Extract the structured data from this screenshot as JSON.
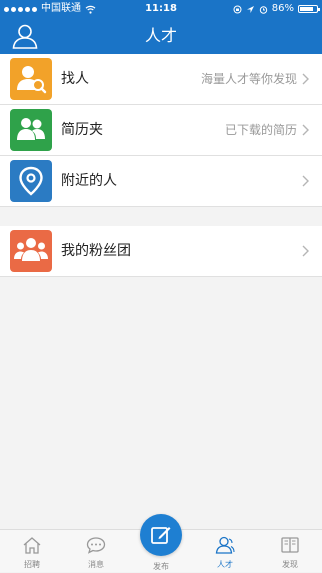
{
  "status_bar": {
    "carrier": "中国联通",
    "time": "11:18",
    "battery": "86%",
    "battery_level_percent": 86
  },
  "header": {
    "title": "人才",
    "profile_icon": "person-outline-icon"
  },
  "menu_top": [
    {
      "label": "找人",
      "desc": "海量人才等你发现",
      "icon": "search-person-icon",
      "color": "#f2a229"
    },
    {
      "label": "简历夹",
      "desc": "已下载的简历",
      "icon": "people-icon",
      "color": "#2fa24a"
    },
    {
      "label": "附近的人",
      "desc": "",
      "icon": "location-pin-icon",
      "color": "#2b7bc3"
    }
  ],
  "menu_bottom": [
    {
      "label": "我的粉丝团",
      "desc": "",
      "icon": "group-icon",
      "color": "#ea6a45"
    }
  ],
  "tab_bar": {
    "tabs": [
      {
        "label": "招聘",
        "icon": "home-icon",
        "active": false
      },
      {
        "label": "消息",
        "icon": "chat-bubble-icon",
        "active": false
      },
      {
        "label": "发布",
        "icon": "edit-icon",
        "active": false
      },
      {
        "label": "人才",
        "icon": "person-icon",
        "active": true
      },
      {
        "label": "发现",
        "icon": "book-icon",
        "active": false
      }
    ]
  },
  "colors": {
    "primary": "#1a74c7",
    "background": "#f3f3f3"
  }
}
